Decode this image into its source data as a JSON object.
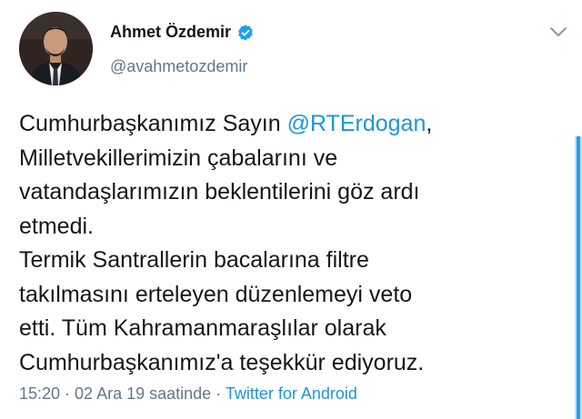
{
  "user": {
    "display_name": "Ahmet Özdemir",
    "handle": "@avahmetozdemir",
    "verified": true
  },
  "icons": {
    "verified": "verified-badge-icon",
    "more": "chevron-down-icon"
  },
  "tweet": {
    "lines": [
      {
        "before": "Cumhurbaşkanımız Sayın ",
        "mention": "@RTErdogan",
        "after": ","
      },
      {
        "text": "Milletvekillerimizin çabalarını ve"
      },
      {
        "text": "vatandaşlarımızın beklentilerini göz ardı"
      },
      {
        "text": "etmedi."
      },
      {
        "text": "Termik Santrallerin bacalarına filtre"
      },
      {
        "text": "takılmasını erteleyen düzenlemeyi veto"
      },
      {
        "text": "etti. Tüm Kahramanmaraşlılar olarak"
      },
      {
        "text": "Cumhurbaşkanımız'a teşekkür ediyoruz."
      }
    ]
  },
  "meta": {
    "timestamp": "15:20 · 02 Ara 19 saatinde · ",
    "source": "Twitter for Android"
  },
  "colors": {
    "link": "#1b95e0",
    "secondary_text": "#657786",
    "verified": "#1da1f2"
  }
}
